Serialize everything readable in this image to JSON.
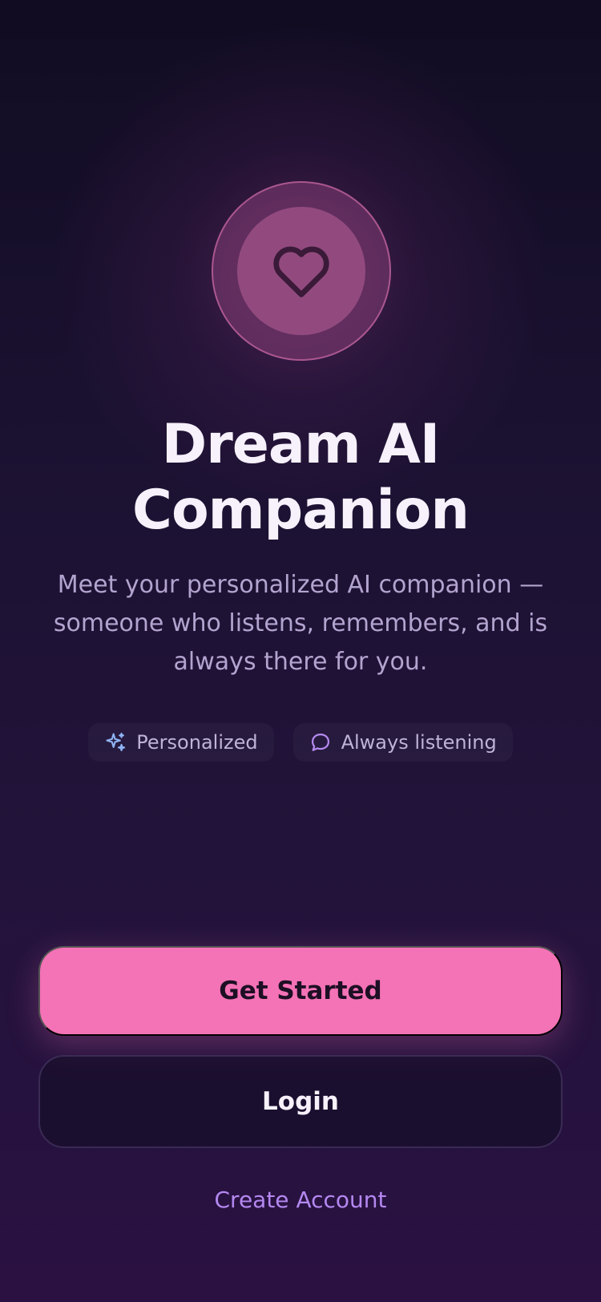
{
  "app": {
    "title_line1": "Dream AI",
    "title_line2": "Companion",
    "subtitle": "Meet your personalized AI companion — someone who listens, remembers, and is always there for you."
  },
  "logo": {
    "icon": "heart-icon"
  },
  "features": [
    {
      "icon": "sparkle-icon",
      "label": "Personalized",
      "color": "#8fb4f5"
    },
    {
      "icon": "chat-bubble-icon",
      "label": "Always listening",
      "color": "#b58af0"
    }
  ],
  "actions": {
    "primary_label": "Get Started",
    "secondary_label": "Login",
    "link_label": "Create Account"
  },
  "colors": {
    "accent": "#f472b6",
    "link": "#b488f0",
    "background": "#1a1130"
  }
}
